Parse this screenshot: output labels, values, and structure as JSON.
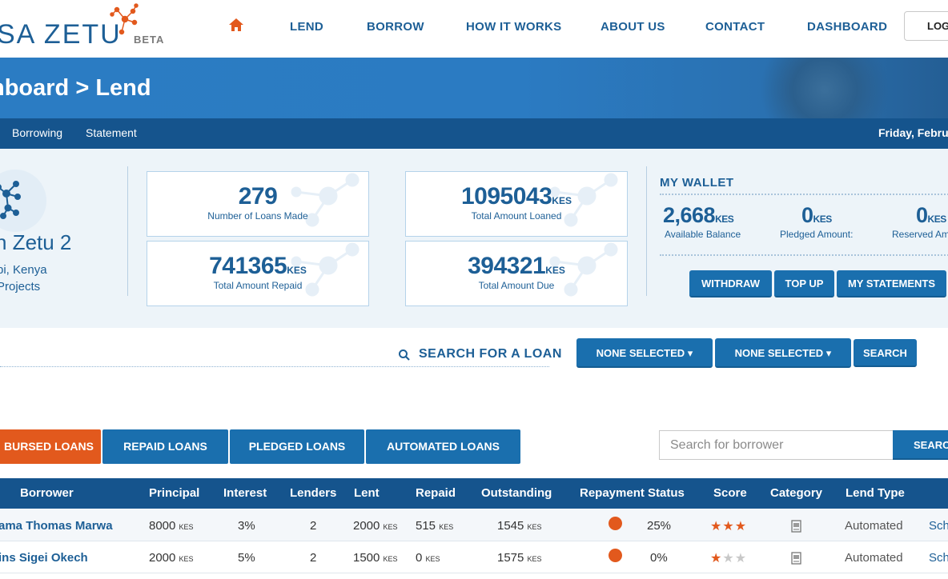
{
  "header": {
    "logo_text": "SA ZETU",
    "logo_badge": "BETA",
    "nav": [
      "LEND",
      "BORROW",
      "HOW IT WORKS",
      "ABOUT US",
      "CONTACT",
      "DASHBOARD"
    ],
    "login_label": "LOG"
  },
  "banner": {
    "title": "hboard > Lend"
  },
  "subnav": {
    "items": [
      "Borrowing",
      "Statement"
    ],
    "date": "Friday, Februa"
  },
  "profile": {
    "name": "n Zetu 2",
    "location": "bi, Kenya",
    "projects": "Projects"
  },
  "stats": [
    {
      "value": "279",
      "unit": "",
      "label": "Number of Loans Made"
    },
    {
      "value": "1095043",
      "unit": "KES",
      "label": "Total Amount Loaned"
    },
    {
      "value": "741365",
      "unit": "KES",
      "label": "Total Amount Repaid"
    },
    {
      "value": "394321",
      "unit": "KES",
      "label": "Total Amount Due"
    }
  ],
  "wallet": {
    "title": "MY WALLET",
    "items": [
      {
        "value": "2,668",
        "unit": "KES",
        "label": "Available Balance"
      },
      {
        "value": "0",
        "unit": "KES",
        "label": "Pledged Amount:"
      },
      {
        "value": "0",
        "unit": "KES",
        "label": "Reserved Am"
      }
    ],
    "buttons": [
      "WITHDRAW",
      "TOP UP",
      "MY STATEMENTS"
    ]
  },
  "search": {
    "label": "SEARCH FOR A LOAN",
    "filter1": "NONE SELECTED",
    "filter2": "NONE SELECTED",
    "button": "SEARCH"
  },
  "tabs": [
    "BURSED LOANS",
    "REPAID LOANS",
    "PLEDGED LOANS",
    "AUTOMATED LOANS"
  ],
  "borrower_search": {
    "placeholder": "Search for borrower",
    "button": "SEARCH"
  },
  "colors": {
    "brand_blue": "#1d5f96",
    "nav_dark": "#15548d",
    "button_blue": "#1a6fae",
    "accent_orange": "#e2591d"
  },
  "table": {
    "columns": [
      "Borrower",
      "Principal",
      "Interest",
      "Lenders",
      "Lent",
      "Repaid",
      "Outstanding",
      "Repayment Status",
      "Score",
      "Category",
      "Lend Type"
    ],
    "currency": "KES",
    "rows": [
      {
        "borrower": "ama Thomas Marwa",
        "principal": "8000",
        "interest": "3%",
        "lenders": "2",
        "lent": "2000",
        "repaid": "515",
        "outstanding": "1545",
        "status_pct": "25%",
        "score": 3,
        "lend_type": "Automated",
        "link": "Sch"
      },
      {
        "borrower": "ins Sigei Okech",
        "principal": "2000",
        "interest": "5%",
        "lenders": "2",
        "lent": "1500",
        "repaid": "0",
        "outstanding": "1575",
        "status_pct": "0%",
        "score": 1,
        "lend_type": "Automated",
        "link": "Sch"
      }
    ]
  }
}
